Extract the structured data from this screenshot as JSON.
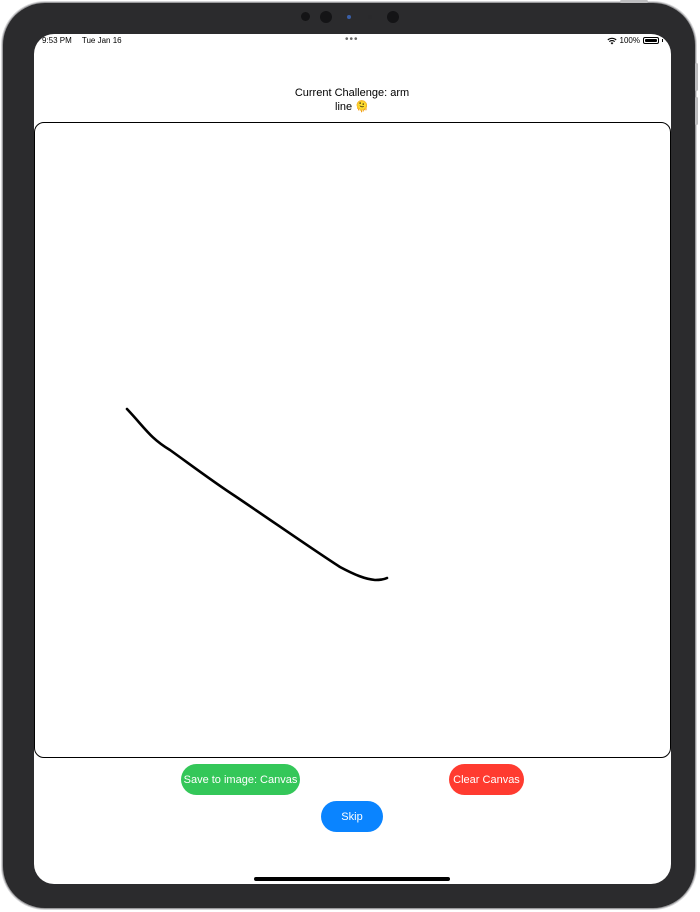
{
  "status_bar": {
    "time": "9:53 PM",
    "date": "Tue Jan 16",
    "multitask_dots": "•••",
    "battery_percent": "100%",
    "wifi_icon": "wifi-icon",
    "battery_icon": "battery-icon"
  },
  "challenge": {
    "line1": "Current Challenge: arm",
    "line2": "line 🫠"
  },
  "canvas": {
    "stroke_color": "#000000"
  },
  "buttons": {
    "save_label": "Save to image: Canvas",
    "clear_label": "Clear Canvas",
    "skip_label": "Skip"
  },
  "colors": {
    "save": "#34c759",
    "clear": "#ff3b30",
    "skip": "#0a84ff"
  }
}
